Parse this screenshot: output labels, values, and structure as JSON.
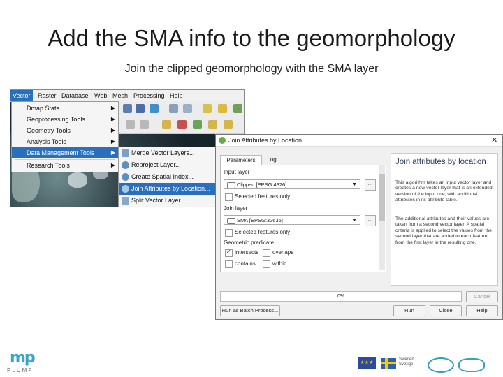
{
  "slide": {
    "title": "Add the SMA info to the geomorphology",
    "subtitle": "Join the clipped geomorphology with the SMA layer"
  },
  "menubar": {
    "items": [
      "Vector",
      "Raster",
      "Database",
      "Web",
      "Mesh",
      "Processing",
      "Help"
    ],
    "active": "Vector"
  },
  "vector_menu": {
    "items": [
      {
        "label": "Dmap Stats",
        "submenu": true
      },
      {
        "label": "Geoprocessing Tools",
        "submenu": true
      },
      {
        "label": "Geometry Tools",
        "submenu": true
      },
      {
        "label": "Analysis Tools",
        "submenu": true
      },
      {
        "label": "Data Management Tools",
        "submenu": true,
        "highlighted": true
      },
      {
        "label": "Research Tools",
        "submenu": true
      }
    ]
  },
  "submenu": {
    "items": [
      {
        "label": "Merge Vector Layers...",
        "icon": "merge-icon"
      },
      {
        "label": "Reproject Layer...",
        "icon": "gear-icon"
      },
      {
        "label": "Create Spatial Index...",
        "icon": "gear-icon"
      },
      {
        "label": "Join Attributes by Location...",
        "icon": "gear-icon",
        "highlighted": true
      },
      {
        "label": "Split Vector Layer...",
        "icon": "split-icon"
      }
    ]
  },
  "dialog": {
    "title": "Join Attributes by Location",
    "close": "✕",
    "tabs": [
      "Parameters",
      "Log"
    ],
    "input_layer_label": "Input layer",
    "input_layer_value": "Clipped [EPSG:4326]",
    "selected_features_only_1": "Selected features only",
    "join_layer_label": "Join layer",
    "join_layer_value": "SMA [EPSG:32636]",
    "selected_features_only_2": "Selected features only",
    "geometric_predicate_label": "Geometric predicate",
    "predicates": [
      {
        "label": "intersects",
        "checked": true
      },
      {
        "label": "overlaps",
        "checked": false
      },
      {
        "label": "contains",
        "checked": false
      },
      {
        "label": "within",
        "checked": false
      }
    ],
    "browse": "…",
    "help_title": "Join attributes by location",
    "help_paragraph_1": "This algorithm takes an input vector layer and creates a new vector layer that is an extended version of the input one, with additional attributes in its attribute table.",
    "help_paragraph_2": "The additional attributes and their values are taken from a second vector layer. A spatial criteria is applied to select the values from the second layer that are added to each feature from the first layer in the resulting one.",
    "progress": "0%",
    "buttons": {
      "cancel": "Cancel",
      "batch": "Run as Batch Process...",
      "run": "Run",
      "close": "Close",
      "help": "Help"
    }
  },
  "logos": {
    "left_word": "PLUMP",
    "sweden_text": "Sweden Sverige"
  },
  "colors": {
    "highlight": "#2a6fbe",
    "help_title": "#2e3b5a"
  }
}
